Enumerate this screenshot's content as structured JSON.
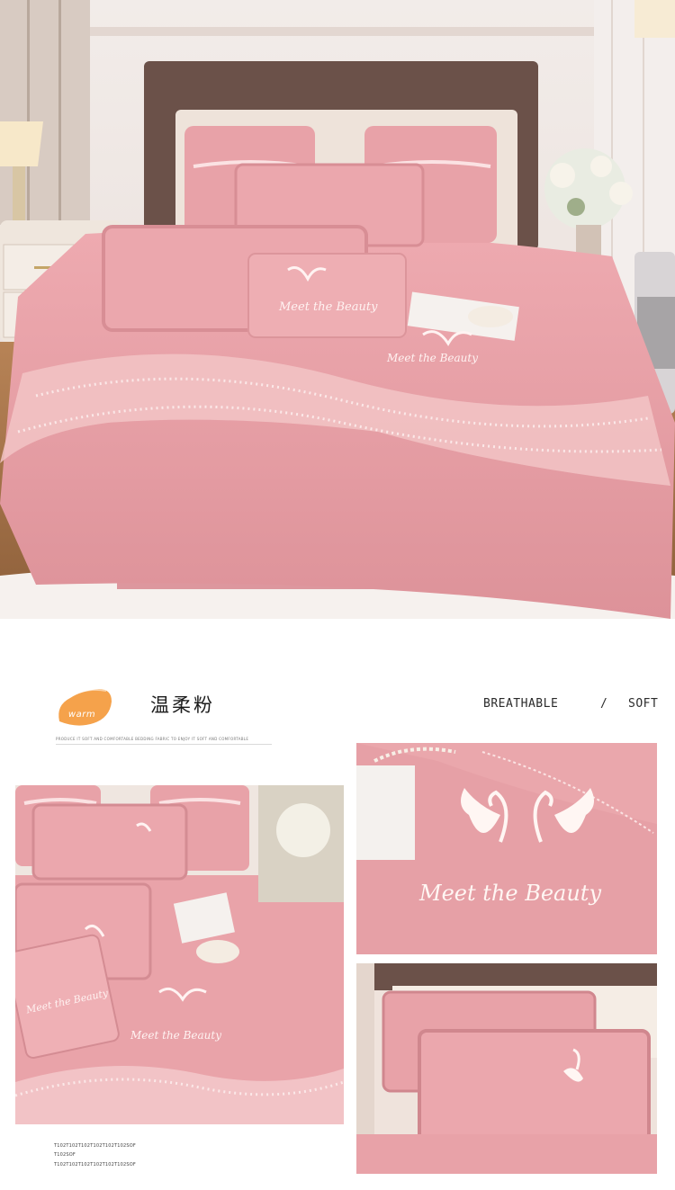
{
  "color_name": "温柔粉",
  "swatch_label": "warm",
  "features": {
    "first": "BREATHABLE",
    "separator": "/",
    "second": "SOFT"
  },
  "fine_print": "PRODUCE IT SOFT AND COMFORTABLE BEDDING FABRIC TO ENJOY IT SOFT AND COMFORTABLE",
  "code_lines": [
    "T102T102T102T102T102T102SOF",
    "T102SOF",
    "T102T102T102T102T102T102SOF"
  ],
  "embroidery_text": "Meet the Beauty",
  "colors": {
    "fabric_pink": "#e8a2a8",
    "fabric_shadow": "#c97f86",
    "swatch_orange": "#f5a24b",
    "headboard_brown": "#6b5149",
    "wall": "#efe7e3"
  }
}
